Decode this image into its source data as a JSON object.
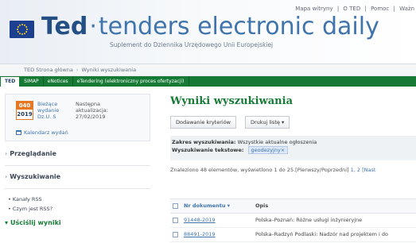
{
  "header": {
    "top_links": [
      "Mapa witryny",
      "|",
      "O TED",
      "|",
      "Pomoc",
      "|",
      "Ważn"
    ],
    "logo_ted": "Ted",
    "logo_dot": "·",
    "logo_rest": "tenders electronic daily",
    "subtitle": "Suplement do Dziennika Urzędowego Unii Europejskiej"
  },
  "breadcrumb": {
    "home": "TED Strona główna",
    "current": "Wyniki wyszukiwania"
  },
  "tabs": [
    {
      "label": "TED",
      "active": true
    },
    {
      "label": "SIMAP",
      "active": false
    },
    {
      "label": "eNotices",
      "active": false
    },
    {
      "label": "eTendering (elektroniczny proces ofertyzacji)",
      "active": false
    }
  ],
  "edition": {
    "number": "040",
    "year": "2019",
    "current_line1": "Bieżące",
    "current_line2": "wydanie",
    "current_line3": "Dz.U. S",
    "update_line1": "Następna",
    "update_line2": "aktualizacja:",
    "update_line3": "27/02/2019",
    "calendar_label": "Kalendarz wydań"
  },
  "sidebar": {
    "browse": "Przeglądanie",
    "search": "Wyszukiwanie",
    "rss": "Kanały RSS",
    "what_rss": "Czym jest RSS?",
    "refine": "Uściślij wyniki"
  },
  "main": {
    "title": "Wyniki wyszukiwania",
    "add_criteria": "Dodawanie kryteriów",
    "print_list": "Drukuj listę",
    "print_caret": "▾",
    "scope_label": "Zakres wyszukiwania:",
    "scope_value": "Wszystkie aktualne ogłoszenia",
    "text_search_label": "Wyszukiwanie tekstowe:",
    "text_search_tag": "geodezyjny",
    "text_search_tag_x": "×",
    "count_text": "Znaleziono 48 elementów, wyświetlono 1 do 25.[Pierwszy/Poprzedni]",
    "count_pages": "1, 2 [Nast"
  },
  "results": {
    "col_doc": "Nr dokumentu",
    "col_doc_sort": "▾",
    "col_desc": "Opis",
    "rows": [
      {
        "doc": "91448-2019",
        "desc": "Polska–Poznań: Różne usługi inżynieryjne"
      },
      {
        "doc": "88491-2019",
        "desc": "Polska–Radzyń Podlaski: Nadzór nad projektem i do"
      }
    ]
  },
  "colors": {
    "green": "#167a35",
    "blue": "#3f74ac",
    "orange": "#e87722",
    "navy": "#234f85"
  }
}
